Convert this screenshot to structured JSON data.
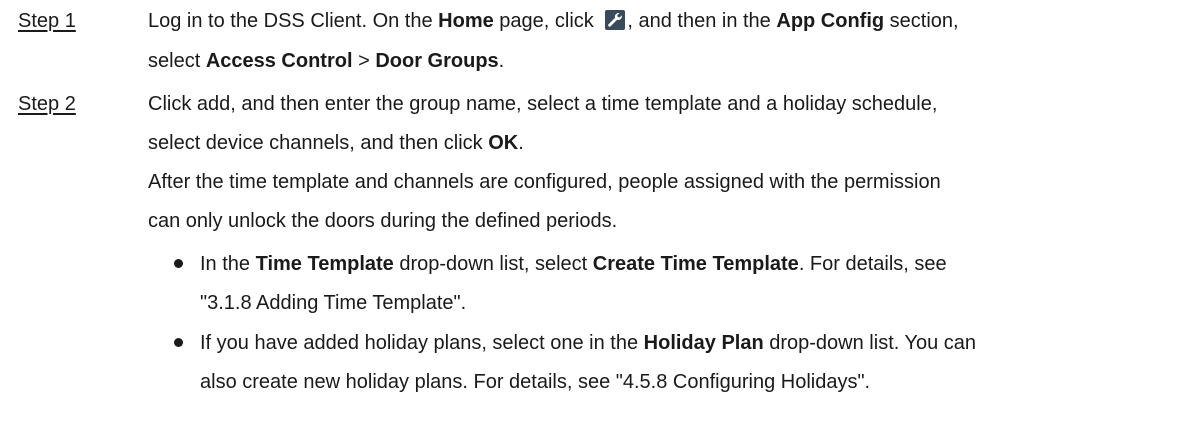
{
  "step1": {
    "label": "Step 1",
    "l1_a": "Log in to the DSS Client. On the ",
    "l1_b": "Home",
    "l1_c": " page, click ",
    "l1_d": ", and then in the ",
    "l1_e": "App Config",
    "l1_f": " section,",
    "l2_a": "select ",
    "l2_b": "Access Control",
    "l2_c": " > ",
    "l2_d": "Door Groups",
    "l2_e": ".",
    "icon": "wrench-icon"
  },
  "step2": {
    "label": "Step 2",
    "l1": "Click add, and then enter the group name, select a time template and a holiday schedule,",
    "l2_a": "select device channels, and then click ",
    "l2_b": "OK",
    "l2_c": ".",
    "l3": "After the time template and channels are configured, people assigned with the permission",
    "l4": "can only unlock the doors during the defined periods."
  },
  "bullets": [
    {
      "l1_a": "In the ",
      "l1_b": "Time Template",
      "l1_c": " drop-down list, select ",
      "l1_d": "Create Time Template",
      "l1_e": ". For details, see",
      "l2": "\"3.1.8 Adding Time Template\"."
    },
    {
      "l1_a": "If you have added holiday plans, select one in the ",
      "l1_b": "Holiday Plan",
      "l1_c": " drop-down list. You can",
      "l2": "also create new holiday plans. For details, see \"4.5.8 Configuring Holidays\"."
    }
  ]
}
